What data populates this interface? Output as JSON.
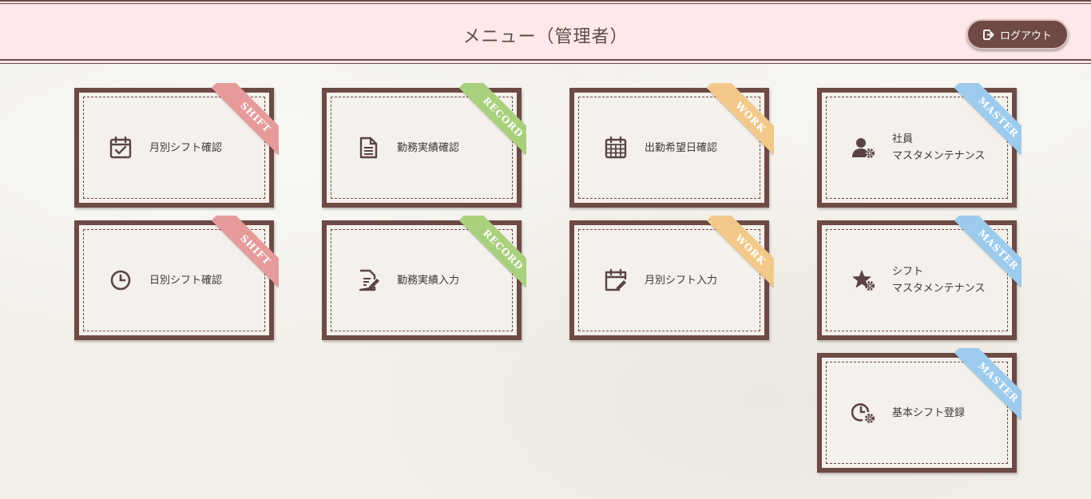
{
  "header": {
    "title": "メニュー（管理者）",
    "logout_label": "ログアウト"
  },
  "colors": {
    "shift": "#e79a9a",
    "record": "#a9d07d",
    "work": "#f2c98a",
    "master": "#9ccbee",
    "frame": "#6e4a45"
  },
  "cards": [
    {
      "label": "月別シフト確認",
      "tag": "SHIFT",
      "icon": "calendar-check-icon"
    },
    {
      "label": "日別シフト確認",
      "tag": "SHIFT",
      "icon": "clock-icon"
    },
    {
      "label": "勤務実績確認",
      "tag": "RECORD",
      "icon": "document-icon"
    },
    {
      "label": "勤務実績入力",
      "tag": "RECORD",
      "icon": "document-edit-icon"
    },
    {
      "label": "出勤希望日確認",
      "tag": "WORK",
      "icon": "calendar-grid-icon"
    },
    {
      "label": "月別シフト入力",
      "tag": "WORK",
      "icon": "calendar-edit-icon"
    },
    {
      "label": "社員\nマスタメンテナンス",
      "tag": "MASTER",
      "icon": "user-gear-icon"
    },
    {
      "label": "シフト\nマスタメンテナンス",
      "tag": "MASTER",
      "icon": "star-gear-icon"
    },
    {
      "label": "基本シフト登録",
      "tag": "MASTER",
      "icon": "clock-gear-icon"
    }
  ]
}
